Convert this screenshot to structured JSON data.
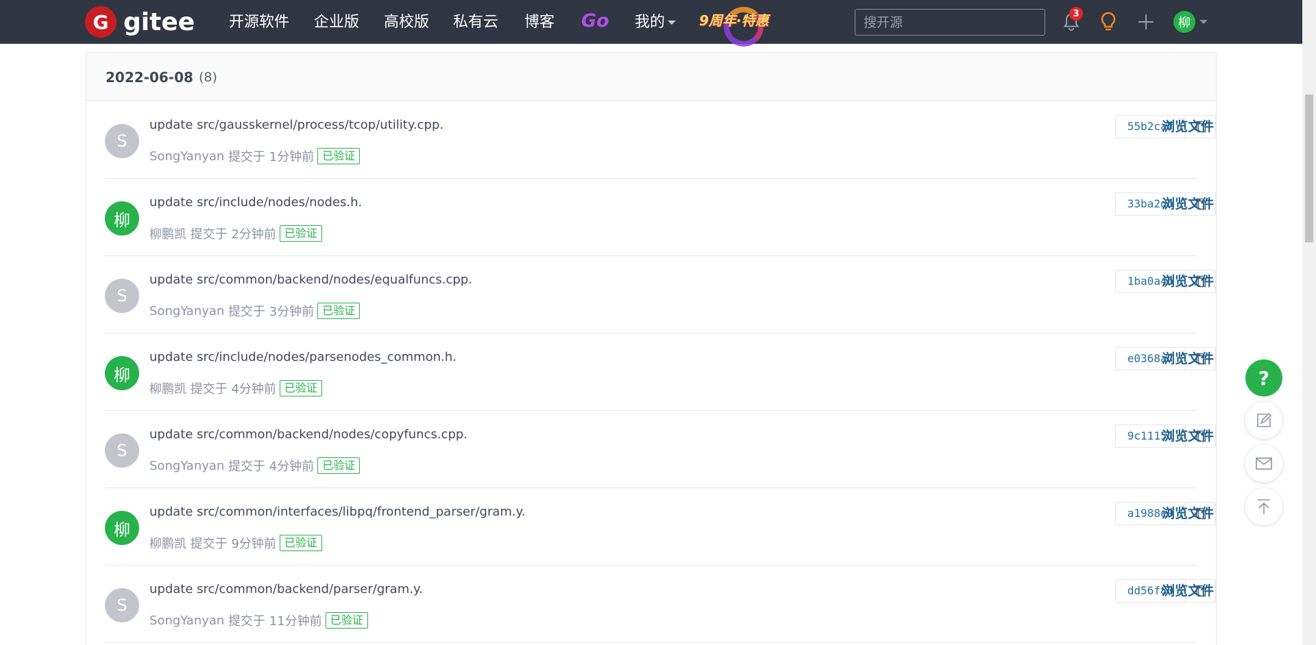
{
  "navbar": {
    "logo_letter": "G",
    "logo_text": "gitee",
    "items": [
      {
        "label": "开源软件"
      },
      {
        "label": "企业版"
      },
      {
        "label": "高校版"
      },
      {
        "label": "私有云"
      },
      {
        "label": "博客"
      },
      {
        "label": "Go"
      },
      {
        "label": "我的"
      }
    ],
    "promo": "9周年·特惠",
    "search_placeholder": "搜开源",
    "notification_count": "3",
    "user_avatar": "柳",
    "icons": [
      "bell-icon",
      "lightbulb-icon",
      "plus-icon",
      "chevron-down-icon"
    ]
  },
  "commits_group": {
    "date": "2022-06-08",
    "count": "(8)",
    "commits": [
      {
        "message": "update src/gausskernel/process/tcop/utility.cpp.",
        "avatar": "S",
        "avatar_color": "grey",
        "author": "SongYanyan",
        "action": "提交于",
        "time": "1分钟前",
        "verified": "已验证",
        "sha": "55b2caf",
        "browse": "浏览文件"
      },
      {
        "message": "update src/include/nodes/nodes.h.",
        "avatar": "柳",
        "avatar_color": "green",
        "author": "柳鹏凯",
        "action": "提交于",
        "time": "2分钟前",
        "verified": "已验证",
        "sha": "33ba2db",
        "browse": "浏览文件"
      },
      {
        "message": "update src/common/backend/nodes/equalfuncs.cpp.",
        "avatar": "S",
        "avatar_color": "grey",
        "author": "SongYanyan",
        "action": "提交于",
        "time": "3分钟前",
        "verified": "已验证",
        "sha": "1ba0a4b",
        "browse": "浏览文件"
      },
      {
        "message": "update src/include/nodes/parsenodes_common.h.",
        "avatar": "柳",
        "avatar_color": "green",
        "author": "柳鹏凯",
        "action": "提交于",
        "time": "4分钟前",
        "verified": "已验证",
        "sha": "e0368a7",
        "browse": "浏览文件"
      },
      {
        "message": "update src/common/backend/nodes/copyfuncs.cpp.",
        "avatar": "S",
        "avatar_color": "grey",
        "author": "SongYanyan",
        "action": "提交于",
        "time": "4分钟前",
        "verified": "已验证",
        "sha": "9c11151",
        "browse": "浏览文件"
      },
      {
        "message": "update src/common/interfaces/libpq/frontend_parser/gram.y.",
        "avatar": "柳",
        "avatar_color": "green",
        "author": "柳鹏凯",
        "action": "提交于",
        "time": "9分钟前",
        "verified": "已验证",
        "sha": "a1988e9",
        "browse": "浏览文件"
      },
      {
        "message": "update src/common/backend/parser/gram.y.",
        "avatar": "S",
        "avatar_color": "grey",
        "author": "SongYanyan",
        "action": "提交于",
        "time": "11分钟前",
        "verified": "已验证",
        "sha": "dd56f80",
        "browse": "浏览文件"
      }
    ]
  },
  "floating": {
    "help": "?",
    "icons": [
      "question-icon",
      "feedback-edit-icon",
      "mail-icon",
      "back-to-top-icon"
    ]
  },
  "colors": {
    "navbar_bg": "#2f3541",
    "brand_red": "#c71d23",
    "verified_green": "#27b24c",
    "link_blue": "#1f5e8c"
  }
}
